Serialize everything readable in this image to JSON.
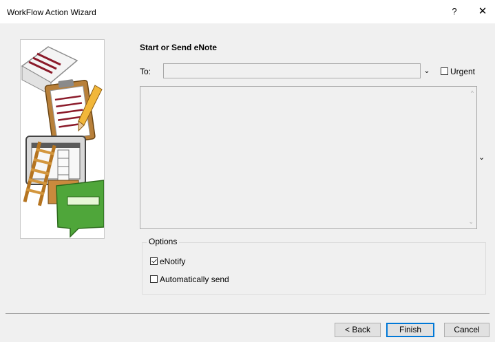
{
  "window": {
    "title": "WorkFlow Action Wizard",
    "help_label": "?",
    "close_label": "✕"
  },
  "heading": "Start or Send eNote",
  "to_field": {
    "label": "To:",
    "value": "",
    "dropdown_glyph": "⌄"
  },
  "urgent": {
    "label": "Urgent",
    "checked": false
  },
  "message": {
    "value": "",
    "scroll_up_glyph": "^",
    "scroll_down_glyph": "⌄",
    "expand_glyph": "⌄"
  },
  "options": {
    "legend": "Options",
    "enotify": {
      "label": "eNotify",
      "checked": true
    },
    "auto_send": {
      "label": "Automatically send",
      "checked": false
    }
  },
  "buttons": {
    "back": "< Back",
    "finish": "Finish",
    "cancel": "Cancel"
  },
  "colors": {
    "accent": "#0078d7",
    "window_bg": "#f0f0f0"
  }
}
